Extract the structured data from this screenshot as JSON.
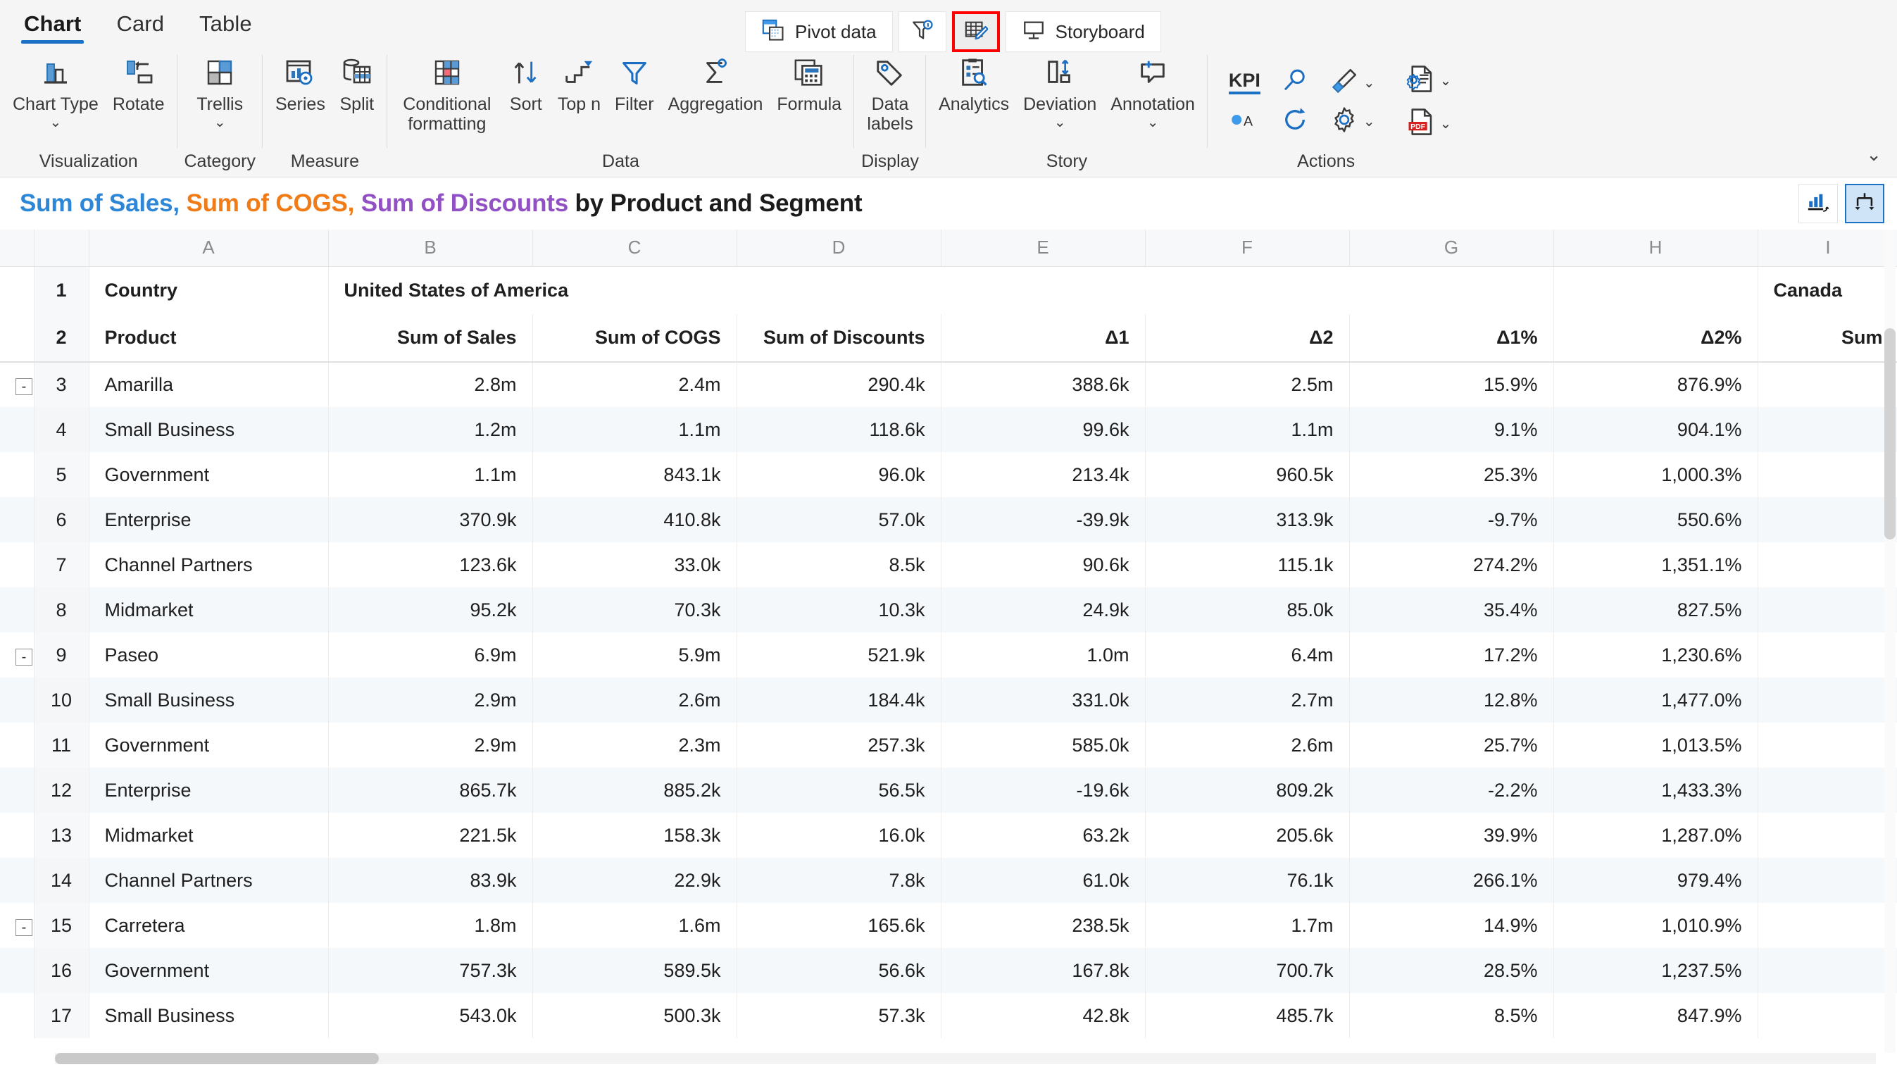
{
  "ribbon": {
    "tabs": [
      {
        "label": "Chart",
        "active": true
      },
      {
        "label": "Card",
        "active": false
      },
      {
        "label": "Table",
        "active": false
      }
    ],
    "command_bar": [
      {
        "label": "Pivot  data",
        "icon": "pivot-data-icon",
        "selected": false
      },
      {
        "label": "",
        "icon": "filter-info-icon",
        "selected": false
      },
      {
        "label": "",
        "icon": "table-edit-icon",
        "selected": true
      },
      {
        "label": "Storyboard",
        "icon": "storyboard-icon",
        "selected": false
      }
    ],
    "groups": [
      {
        "title": "Visualization",
        "items": [
          {
            "label": "Chart Type",
            "icon": "chart-type-icon",
            "dropdown": true
          },
          {
            "label": "Rotate",
            "icon": "rotate-icon",
            "dropdown": false
          }
        ]
      },
      {
        "title": "Category",
        "items": [
          {
            "label": "Trellis",
            "icon": "trellis-icon",
            "dropdown": true
          }
        ]
      },
      {
        "title": "Measure",
        "items": [
          {
            "label": "Series",
            "icon": "series-icon",
            "dropdown": false
          },
          {
            "label": "Split",
            "icon": "split-icon",
            "dropdown": false
          }
        ]
      },
      {
        "title": "Data",
        "items": [
          {
            "label": "Conditional\nformatting",
            "icon": "conditional-formatting-icon",
            "dropdown": "inline"
          },
          {
            "label": "Sort",
            "icon": "sort-icon",
            "dropdown": false
          },
          {
            "label": "Top n",
            "icon": "top-n-icon",
            "dropdown": false
          },
          {
            "label": "Filter",
            "icon": "filter-icon",
            "dropdown": false
          },
          {
            "label": "Aggregation",
            "icon": "aggregation-icon",
            "dropdown": false
          },
          {
            "label": "Formula",
            "icon": "formula-icon",
            "dropdown": false
          }
        ]
      },
      {
        "title": "Display",
        "items": [
          {
            "label": "Data\nlabels",
            "icon": "data-labels-icon",
            "dropdown": false
          }
        ]
      },
      {
        "title": "Story",
        "items": [
          {
            "label": "Analytics",
            "icon": "analytics-icon",
            "dropdown": false
          },
          {
            "label": "Deviation",
            "icon": "deviation-icon",
            "dropdown": true
          },
          {
            "label": "Annotation",
            "icon": "annotation-icon",
            "dropdown": true
          }
        ]
      },
      {
        "title": "Actions",
        "items": [
          {
            "label": "KPI",
            "icon": "kpi-icon",
            "dropdown": false
          },
          {
            "label": "",
            "icon": "search-icon",
            "dropdown": false
          },
          {
            "label": "",
            "icon": "paintbrush-icon",
            "dropdown": true
          },
          {
            "label": "",
            "icon": "scale-auto-icon",
            "dropdown": false
          },
          {
            "label": "",
            "icon": "refresh-icon",
            "dropdown": false
          },
          {
            "label": "",
            "icon": "settings-gear-icon",
            "dropdown": true
          },
          {
            "label": "",
            "icon": "document-settings-icon",
            "dropdown": true
          },
          {
            "label": "",
            "icon": "pdf-export-icon",
            "dropdown": true
          }
        ]
      }
    ],
    "collapse_icon": "chevron-down-icon"
  },
  "title": {
    "part_sales": "Sum of Sales,",
    "part_cogs": " Sum of COGS,",
    "part_discounts": " Sum of Discounts",
    "part_rest": " by Product and Segment",
    "colors": {
      "sales": "#2e86d6",
      "cogs": "#f07b17",
      "discounts": "#9150c4",
      "rest": "#1b1b1b"
    },
    "buttons": [
      {
        "icon": "chart-view-icon",
        "selected": false
      },
      {
        "icon": "drill-down-icon",
        "selected": true
      }
    ]
  },
  "chart_data": {
    "type": "table",
    "title": "Sum of Sales, Sum of COGS, Sum of Discounts by Product and Segment",
    "column_letters": [
      "",
      "A",
      "B",
      "C",
      "D",
      "E",
      "F",
      "G",
      "H",
      "I"
    ],
    "group_header": {
      "row_number": "1",
      "label": "Country",
      "usa": "United States of America",
      "canada": "Canada"
    },
    "column_headers": {
      "row_number": "2",
      "labels": [
        "Product",
        "Sum of  Sales",
        "Sum of COGS",
        "Sum of Discounts",
        "Δ1",
        "Δ2",
        "Δ1%",
        "Δ2%",
        "Sum"
      ]
    },
    "rows": [
      {
        "n": "3",
        "label": "Amarilla",
        "level": 0,
        "expander": "-",
        "alt": false,
        "values": [
          "2.8m",
          "2.4m",
          "290.4k",
          "388.6k",
          "2.5m",
          "15.9%",
          "876.9%",
          ""
        ]
      },
      {
        "n": "4",
        "label": "Small Business",
        "level": 1,
        "expander": "",
        "alt": true,
        "values": [
          "1.2m",
          "1.1m",
          "118.6k",
          "99.6k",
          "1.1m",
          "9.1%",
          "904.1%",
          ""
        ]
      },
      {
        "n": "5",
        "label": "Government",
        "level": 1,
        "expander": "",
        "alt": false,
        "values": [
          "1.1m",
          "843.1k",
          "96.0k",
          "213.4k",
          "960.5k",
          "25.3%",
          "1,000.3%",
          ""
        ]
      },
      {
        "n": "6",
        "label": "Enterprise",
        "level": 1,
        "expander": "",
        "alt": true,
        "values": [
          "370.9k",
          "410.8k",
          "57.0k",
          "-39.9k",
          "313.9k",
          "-9.7%",
          "550.6%",
          ""
        ]
      },
      {
        "n": "7",
        "label": "Channel Partners",
        "level": 1,
        "expander": "",
        "alt": false,
        "values": [
          "123.6k",
          "33.0k",
          "8.5k",
          "90.6k",
          "115.1k",
          "274.2%",
          "1,351.1%",
          ""
        ]
      },
      {
        "n": "8",
        "label": "Midmarket",
        "level": 1,
        "expander": "",
        "alt": true,
        "values": [
          "95.2k",
          "70.3k",
          "10.3k",
          "24.9k",
          "85.0k",
          "35.4%",
          "827.5%",
          ""
        ]
      },
      {
        "n": "9",
        "label": "Paseo",
        "level": 0,
        "expander": "-",
        "alt": false,
        "values": [
          "6.9m",
          "5.9m",
          "521.9k",
          "1.0m",
          "6.4m",
          "17.2%",
          "1,230.6%",
          ""
        ]
      },
      {
        "n": "10",
        "label": "Small Business",
        "level": 1,
        "expander": "",
        "alt": true,
        "values": [
          "2.9m",
          "2.6m",
          "184.4k",
          "331.0k",
          "2.7m",
          "12.8%",
          "1,477.0%",
          ""
        ]
      },
      {
        "n": "11",
        "label": "Government",
        "level": 1,
        "expander": "",
        "alt": false,
        "values": [
          "2.9m",
          "2.3m",
          "257.3k",
          "585.0k",
          "2.6m",
          "25.7%",
          "1,013.5%",
          ""
        ]
      },
      {
        "n": "12",
        "label": "Enterprise",
        "level": 1,
        "expander": "",
        "alt": true,
        "values": [
          "865.7k",
          "885.2k",
          "56.5k",
          "-19.6k",
          "809.2k",
          "-2.2%",
          "1,433.3%",
          ""
        ]
      },
      {
        "n": "13",
        "label": "Midmarket",
        "level": 1,
        "expander": "",
        "alt": false,
        "values": [
          "221.5k",
          "158.3k",
          "16.0k",
          "63.2k",
          "205.6k",
          "39.9%",
          "1,287.0%",
          ""
        ]
      },
      {
        "n": "14",
        "label": "Channel Partners",
        "level": 1,
        "expander": "",
        "alt": true,
        "values": [
          "83.9k",
          "22.9k",
          "7.8k",
          "61.0k",
          "76.1k",
          "266.1%",
          "979.4%",
          ""
        ]
      },
      {
        "n": "15",
        "label": "Carretera",
        "level": 0,
        "expander": "-",
        "alt": false,
        "values": [
          "1.8m",
          "1.6m",
          "165.6k",
          "238.5k",
          "1.7m",
          "14.9%",
          "1,010.9%",
          ""
        ]
      },
      {
        "n": "16",
        "label": "Government",
        "level": 1,
        "expander": "",
        "alt": true,
        "values": [
          "757.3k",
          "589.5k",
          "56.6k",
          "167.8k",
          "700.7k",
          "28.5%",
          "1,237.5%",
          ""
        ]
      },
      {
        "n": "17",
        "label": "Small Business",
        "level": 1,
        "expander": "",
        "alt": false,
        "values": [
          "543.0k",
          "500.3k",
          "57.3k",
          "42.8k",
          "485.7k",
          "8.5%",
          "847.9%",
          ""
        ]
      }
    ]
  }
}
